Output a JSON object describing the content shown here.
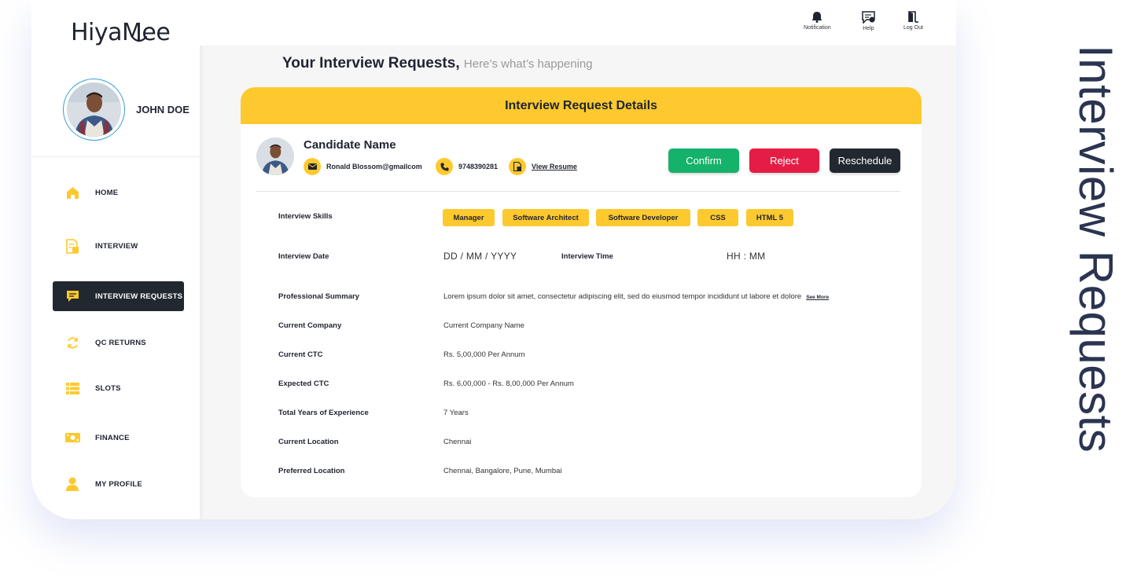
{
  "brand": {
    "logo": "HiyaMee"
  },
  "profile": {
    "name": "JOHN DOE"
  },
  "sidebar": {
    "items": [
      {
        "label": "HOME",
        "icon": "home-icon"
      },
      {
        "label": "INTERVIEW",
        "icon": "document-icon"
      },
      {
        "label": "INTERVIEW REQUESTS",
        "icon": "chat-icon",
        "active": true
      },
      {
        "label": "QC RETURNS",
        "icon": "refresh-icon"
      },
      {
        "label": "SLOTS",
        "icon": "list-icon"
      },
      {
        "label": "FINANCE",
        "icon": "money-icon"
      },
      {
        "label": "MY PROFILE",
        "icon": "user-icon"
      }
    ]
  },
  "topbar": {
    "notification": "Notification",
    "help": "Help",
    "logout": "Log Out"
  },
  "page": {
    "title": "Your Interview Requests,",
    "subtitle": "Here’s what’s happening",
    "side_title": "Interview Requests"
  },
  "card": {
    "header": "Interview Request Details",
    "candidate": {
      "name": "Candidate Name",
      "email": "Ronald Blossom@gmailcom",
      "phone": "9748390281",
      "resume_link": "View Resume"
    },
    "actions": {
      "confirm": "Confirm",
      "reject": "Reject",
      "reschedule": "Reschedule"
    },
    "skills_label": "Interview Skills",
    "skills": [
      "Manager",
      "Software Architect",
      "Software Developer",
      "CSS",
      "HTML 5"
    ],
    "date_label": "Interview Date",
    "date_placeholder": "DD / MM / YYYY",
    "time_label": "Interview Time",
    "time_placeholder": "HH : MM",
    "summary_label": "Professional Summary",
    "summary_value": "Lorem ipsum dolor sit amet, consectetur adipiscing elit, sed do eiusmod tempor incididunt ut labore et dolore",
    "see_more": "See More",
    "details": [
      {
        "label": "Current Company",
        "value": "Current Company Name"
      },
      {
        "label": "Current CTC",
        "value": "Rs. 5,00,000 Per Annum"
      },
      {
        "label": "Expected CTC",
        "value": "Rs. 6,00,000 - Rs. 8,00,000 Per Annum"
      },
      {
        "label": "Total Years of Experience",
        "value": "7 Years"
      },
      {
        "label": "Current Location",
        "value": "Chennai"
      },
      {
        "label": "Preferred Location",
        "value": "Chennai, Bangalore, Pune, Mumbai"
      }
    ]
  },
  "colors": {
    "accent": "#fdc92e",
    "confirm": "#15b26b",
    "reject": "#e51d45",
    "dark": "#222830"
  }
}
